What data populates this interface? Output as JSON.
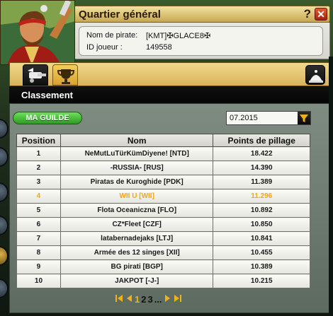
{
  "window": {
    "title": "Quartier général",
    "help_label": "?",
    "close_label": "✕"
  },
  "pirate": {
    "name_label": "Nom de pirate:",
    "name_value": "[KMT]✠GLACE8✠",
    "id_label": "ID joueur :",
    "id_value": "149558"
  },
  "section": {
    "title": "Classement"
  },
  "guild_button": {
    "label": "MA GUILDE"
  },
  "month_select": {
    "value": "07.2015"
  },
  "table": {
    "headers": [
      "Position",
      "Nom",
      "Points de pillage"
    ],
    "highlight_index": 3,
    "rows": [
      {
        "pos": "1",
        "name": "NeMutLuTürKümDiyene! [NTD]",
        "points": "18.422"
      },
      {
        "pos": "2",
        "name": "-RUSSIA- [RUS]",
        "points": "14.390"
      },
      {
        "pos": "3",
        "name": "Piratas de Kuroghide [PDK]",
        "points": "11.389"
      },
      {
        "pos": "4",
        "name": "WII U [WII]",
        "points": "11.296"
      },
      {
        "pos": "5",
        "name": "Flota Oceaniczna [FLO]",
        "points": "10.892"
      },
      {
        "pos": "6",
        "name": "CZ*Fleet [CZF]",
        "points": "10.850"
      },
      {
        "pos": "7",
        "name": "latabernadejaks [LTJ]",
        "points": "10.841"
      },
      {
        "pos": "8",
        "name": "Armée des 12 singes [XII]",
        "points": "10.455"
      },
      {
        "pos": "9",
        "name": "BG pirati [BGP]",
        "points": "10.389"
      },
      {
        "pos": "10",
        "name": "JAKPOT [-J-]",
        "points": "10.215"
      }
    ]
  },
  "pager": {
    "pages": [
      "1",
      "2",
      "3",
      "..."
    ],
    "current": "1",
    "first_icon": "first-page-icon",
    "prev_icon": "prev-page-icon",
    "next_icon": "next-page-icon",
    "last_icon": "last-page-icon"
  },
  "icons": {
    "tab1": "ship-cannon-icon",
    "tab2": "trophy-icon",
    "right": "treasure-pile-icon",
    "filter": "funnel-icon"
  },
  "colors": {
    "accent_gold": "#f0b21a",
    "highlight_row_text": "#f1a615",
    "guild_button_green": "#2e9a23"
  }
}
